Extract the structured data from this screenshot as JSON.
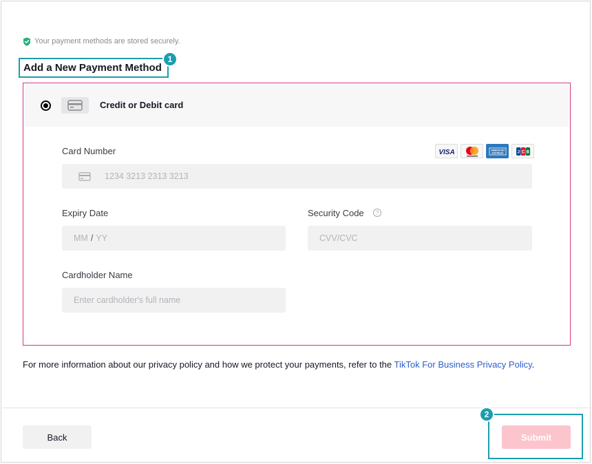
{
  "secure_note": "Your payment methods are stored securely.",
  "section_title": "Add a New Payment Method",
  "callouts": {
    "one": "1",
    "two": "2"
  },
  "payment_method": {
    "label": "Credit or Debit card",
    "selected": true
  },
  "card_brands": [
    "VISA",
    "Mastercard",
    "American Express",
    "JCB"
  ],
  "form": {
    "card_number": {
      "label": "Card Number",
      "placeholder": "1234 3213 2313 3213"
    },
    "expiry": {
      "label": "Expiry Date",
      "placeholder_month": "MM",
      "separator": "/",
      "placeholder_year": "YY"
    },
    "security_code": {
      "label": "Security Code",
      "placeholder": "CVV/CVC",
      "help_icon": "?"
    },
    "cardholder": {
      "label": "Cardholder Name",
      "placeholder": "Enter cardholder's full name"
    }
  },
  "privacy": {
    "text": "For more information about our privacy policy and how we protect your payments, refer to the ",
    "link": "TikTok For Business Privacy Policy",
    "suffix": "."
  },
  "buttons": {
    "back": "Back",
    "submit": "Submit"
  },
  "colors": {
    "accent_teal": "#1b9eac",
    "selected_border": "#d63384",
    "submit_disabled": "#fcc4cc",
    "link": "#2c5ec9",
    "shield_green": "#25b07a"
  }
}
